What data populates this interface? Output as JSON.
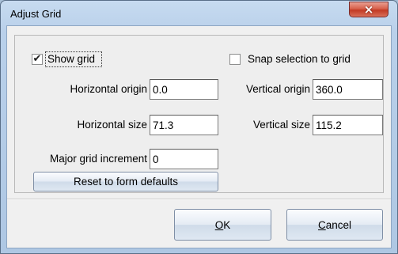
{
  "window": {
    "title": "Adjust Grid",
    "close_symbol": "×"
  },
  "options": {
    "show_grid": {
      "label": "Show grid",
      "checked": true,
      "check_symbol": "✔"
    },
    "snap_to_grid": {
      "label": "Snap selection to grid",
      "checked": false
    }
  },
  "fields": {
    "horizontal_origin": {
      "label": "Horizontal origin",
      "value": "0.0"
    },
    "vertical_origin": {
      "label": "Vertical origin",
      "value": "360.0"
    },
    "horizontal_size": {
      "label": "Horizontal size",
      "value": "71.3"
    },
    "vertical_size": {
      "label": "Vertical size",
      "value": "115.2"
    },
    "major_grid_increment": {
      "label": "Major grid increment",
      "value": "0"
    }
  },
  "buttons": {
    "reset": "Reset to form defaults",
    "ok_mnemonic": "O",
    "ok_rest": "K",
    "cancel_mnemonic": "C",
    "cancel_rest": "ancel"
  },
  "colors": {
    "title_bar": "#b9d0ea",
    "close_button": "#c23a24",
    "dialog_body": "#f0f0f0"
  }
}
